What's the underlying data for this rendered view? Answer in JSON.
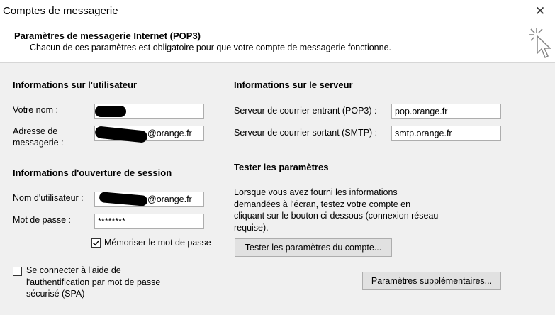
{
  "window": {
    "title": "Comptes de messagerie",
    "close_glyph": "✕"
  },
  "header": {
    "title": "Paramètres de messagerie Internet (POP3)",
    "subtitle": "Chacun de ces paramètres est obligatoire pour que votre compte de messagerie fonctionne.",
    "wizard_icon": "wizard-cursor-icon"
  },
  "user_info": {
    "heading": "Informations sur l'utilisateur",
    "name_label": "Votre nom :",
    "name_value": "",
    "email_label_line1": "Adresse de",
    "email_label_line2": "messagerie :",
    "email_value": "@orange.fr"
  },
  "logon_info": {
    "heading": "Informations d'ouverture de session",
    "username_label": "Nom d'utilisateur :",
    "username_value": "@orange.fr",
    "password_label": "Mot de passe :",
    "password_value": "********",
    "remember_label": "Mémoriser le mot de passe",
    "remember_checked": true
  },
  "spa": {
    "line1": "Se connecter à l'aide de",
    "line2": "l'authentification par mot de passe",
    "line3": "sécurisé (SPA)",
    "checked": false
  },
  "server_info": {
    "heading": "Informations sur le serveur",
    "incoming_label": "Serveur de courrier entrant (POP3) :",
    "incoming_value": "pop.orange.fr",
    "outgoing_label": "Serveur de courrier sortant (SMTP) :",
    "outgoing_value": "smtp.orange.fr"
  },
  "test": {
    "heading": "Tester les paramètres",
    "line1": "Lorsque vous avez fourni les informations",
    "line2": "demandées à l'écran, testez votre compte en",
    "line3": "cliquant sur le bouton ci-dessous (connexion réseau",
    "line4": "requise).",
    "button": "Tester les paramètres du compte..."
  },
  "more_button": "Paramètres supplémentaires...",
  "colors": {
    "background": "#f0f0f0",
    "header": "#ffffff",
    "button": "#e1e1e1",
    "border": "#adadad"
  }
}
